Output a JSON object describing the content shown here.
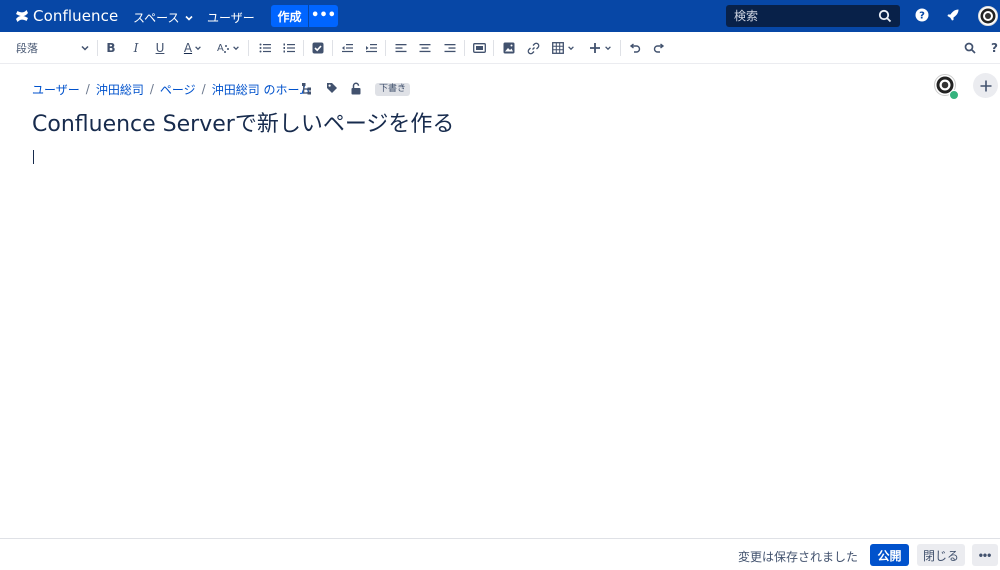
{
  "app": {
    "name": "Confluence"
  },
  "topnav": {
    "spaces": "スペース",
    "users": "ユーザー",
    "create": "作成",
    "more": "•••",
    "search_placeholder": "検索"
  },
  "toolbar": {
    "paragraph_style": "段落",
    "bold": "B",
    "italic": "I",
    "underline": "U",
    "text_color": "A",
    "help": "?"
  },
  "breadcrumb": {
    "items": [
      "ユーザー",
      "沖田総司",
      "ページ",
      "沖田総司 のホーム"
    ],
    "draft_badge": "下書き"
  },
  "page": {
    "title": "Confluence Serverで新しいページを作る"
  },
  "footer": {
    "status": "変更は保存されました",
    "publish": "公開",
    "close": "閉じる",
    "more": "•••"
  },
  "colors": {
    "nav_bg": "#0747a6",
    "create_btn": "#0065ff",
    "link": "#0052cc",
    "publish_btn": "#0052cc"
  }
}
